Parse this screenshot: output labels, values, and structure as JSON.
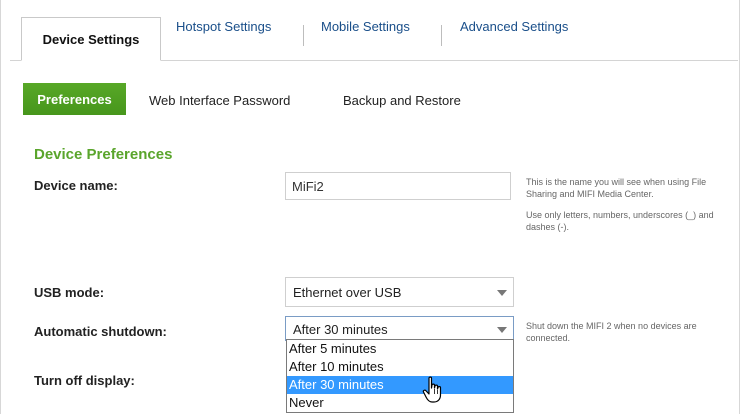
{
  "tabs": {
    "items": [
      {
        "label": "Device Settings",
        "active": true
      },
      {
        "label": "Hotspot Settings",
        "active": false
      },
      {
        "label": "Mobile Settings",
        "active": false
      },
      {
        "label": "Advanced Settings",
        "active": false
      }
    ]
  },
  "subnav": {
    "items": [
      {
        "label": "Preferences",
        "active": true
      },
      {
        "label": "Web Interface Password",
        "active": false
      },
      {
        "label": "Backup and Restore",
        "active": false
      }
    ]
  },
  "section": {
    "title": "Device Preferences"
  },
  "device_name": {
    "label": "Device name:",
    "value": "MiFi2",
    "help1": "This is the name you will see when using File Sharing and MIFI Media Center.",
    "help2": "Use only letters, numbers, underscores (_) and dashes (-)."
  },
  "usb_mode": {
    "label": "USB mode:",
    "value": "Ethernet over USB"
  },
  "auto_shutdown": {
    "label": "Automatic shutdown:",
    "value": "After 30 minutes",
    "help": "Shut down the MIFI 2 when no devices are connected.",
    "options": [
      "After 5 minutes",
      "After 10 minutes",
      "After 30 minutes",
      "Never"
    ],
    "highlighted": "After 30 minutes"
  },
  "display": {
    "label": "Turn off display:"
  },
  "colors": {
    "accent_green": "#5aa52c",
    "highlight_blue": "#3399ff",
    "tab_link_blue": "#1a4f8a"
  },
  "icons": {
    "cursor": "hand-pointer-icon",
    "caret": "chevron-down-icon"
  }
}
